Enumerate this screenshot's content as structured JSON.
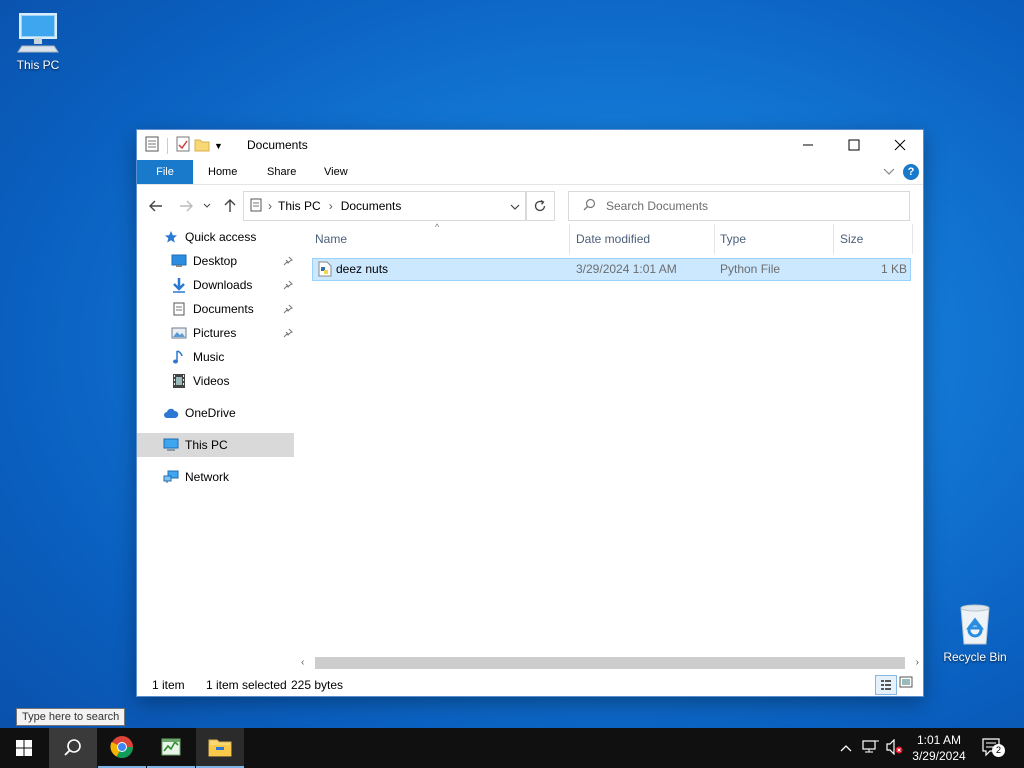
{
  "desktop": {
    "this_pc_label": "This PC",
    "recycle_bin_label": "Recycle Bin"
  },
  "window": {
    "title": "Documents",
    "ribbon_tabs": [
      "File",
      "Home",
      "Share",
      "View"
    ],
    "address": {
      "crumbs": [
        "This PC",
        "Documents"
      ]
    },
    "search_placeholder": "Search Documents",
    "sidebar": {
      "quick_access": "Quick access",
      "items": [
        "Desktop",
        "Downloads",
        "Documents",
        "Pictures",
        "Music",
        "Videos"
      ],
      "onedrive": "OneDrive",
      "this_pc": "This PC",
      "network": "Network"
    },
    "columns": {
      "name": "Name",
      "date": "Date modified",
      "type": "Type",
      "size": "Size"
    },
    "files": [
      {
        "name": "deez nuts",
        "date": "3/29/2024 1:01 AM",
        "type": "Python File",
        "size": "1 KB"
      }
    ],
    "status": {
      "count": "1 item",
      "selected": "1 item selected",
      "bytes": "225 bytes"
    }
  },
  "taskbar": {
    "search_tooltip": "Type here to search",
    "time": "1:01 AM",
    "date": "3/29/2024",
    "notifications": "2"
  }
}
